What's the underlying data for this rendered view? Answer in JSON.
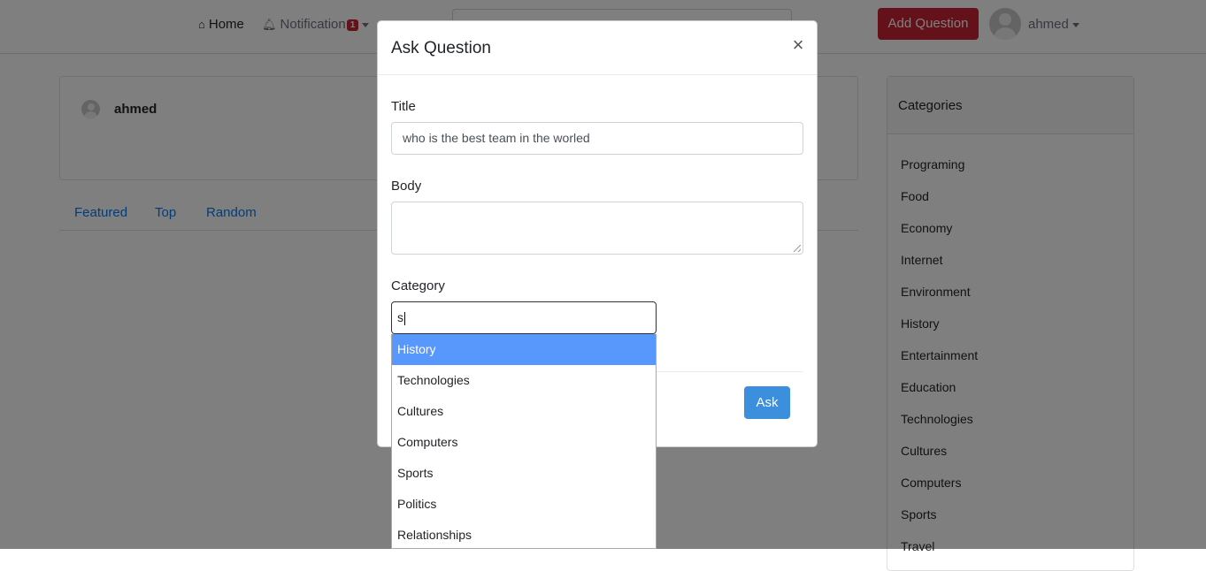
{
  "navbar": {
    "home_label": "Home",
    "notification_label": "Notification",
    "notification_count": "1",
    "add_question_label": "Add Question",
    "username": "ahmed"
  },
  "profile": {
    "name": "ahmed"
  },
  "feed_tabs": [
    "Featured",
    "Top",
    "Random"
  ],
  "categories_panel": {
    "title": "Categories",
    "items": [
      "Programing",
      "Food",
      "Economy",
      "Internet",
      "Environment",
      "History",
      "Entertainment",
      "Education",
      "Technologies",
      "Cultures",
      "Computers",
      "Sports",
      "Travel"
    ]
  },
  "modal": {
    "title": "Ask Question",
    "close_glyph": "×",
    "title_label": "Title",
    "title_value": "who is the best team in the worled",
    "body_label": "Body",
    "body_value": "",
    "category_label": "Category",
    "category_value": "s",
    "ask_label": "Ask"
  },
  "category_dropdown": {
    "options": [
      "History",
      "Technologies",
      "Cultures",
      "Computers",
      "Sports",
      "Politics",
      "Relationships"
    ],
    "highlighted": "History"
  },
  "icons": {
    "home": "home-icon",
    "bell": "bell-icon",
    "search": "search-icon",
    "avatar": "avatar-icon",
    "close": "close-icon"
  },
  "colors": {
    "primary": "#007bff",
    "danger": "#c82333",
    "ask_button": "#3c8fdc",
    "dropdown_highlight": "#5897fb"
  }
}
